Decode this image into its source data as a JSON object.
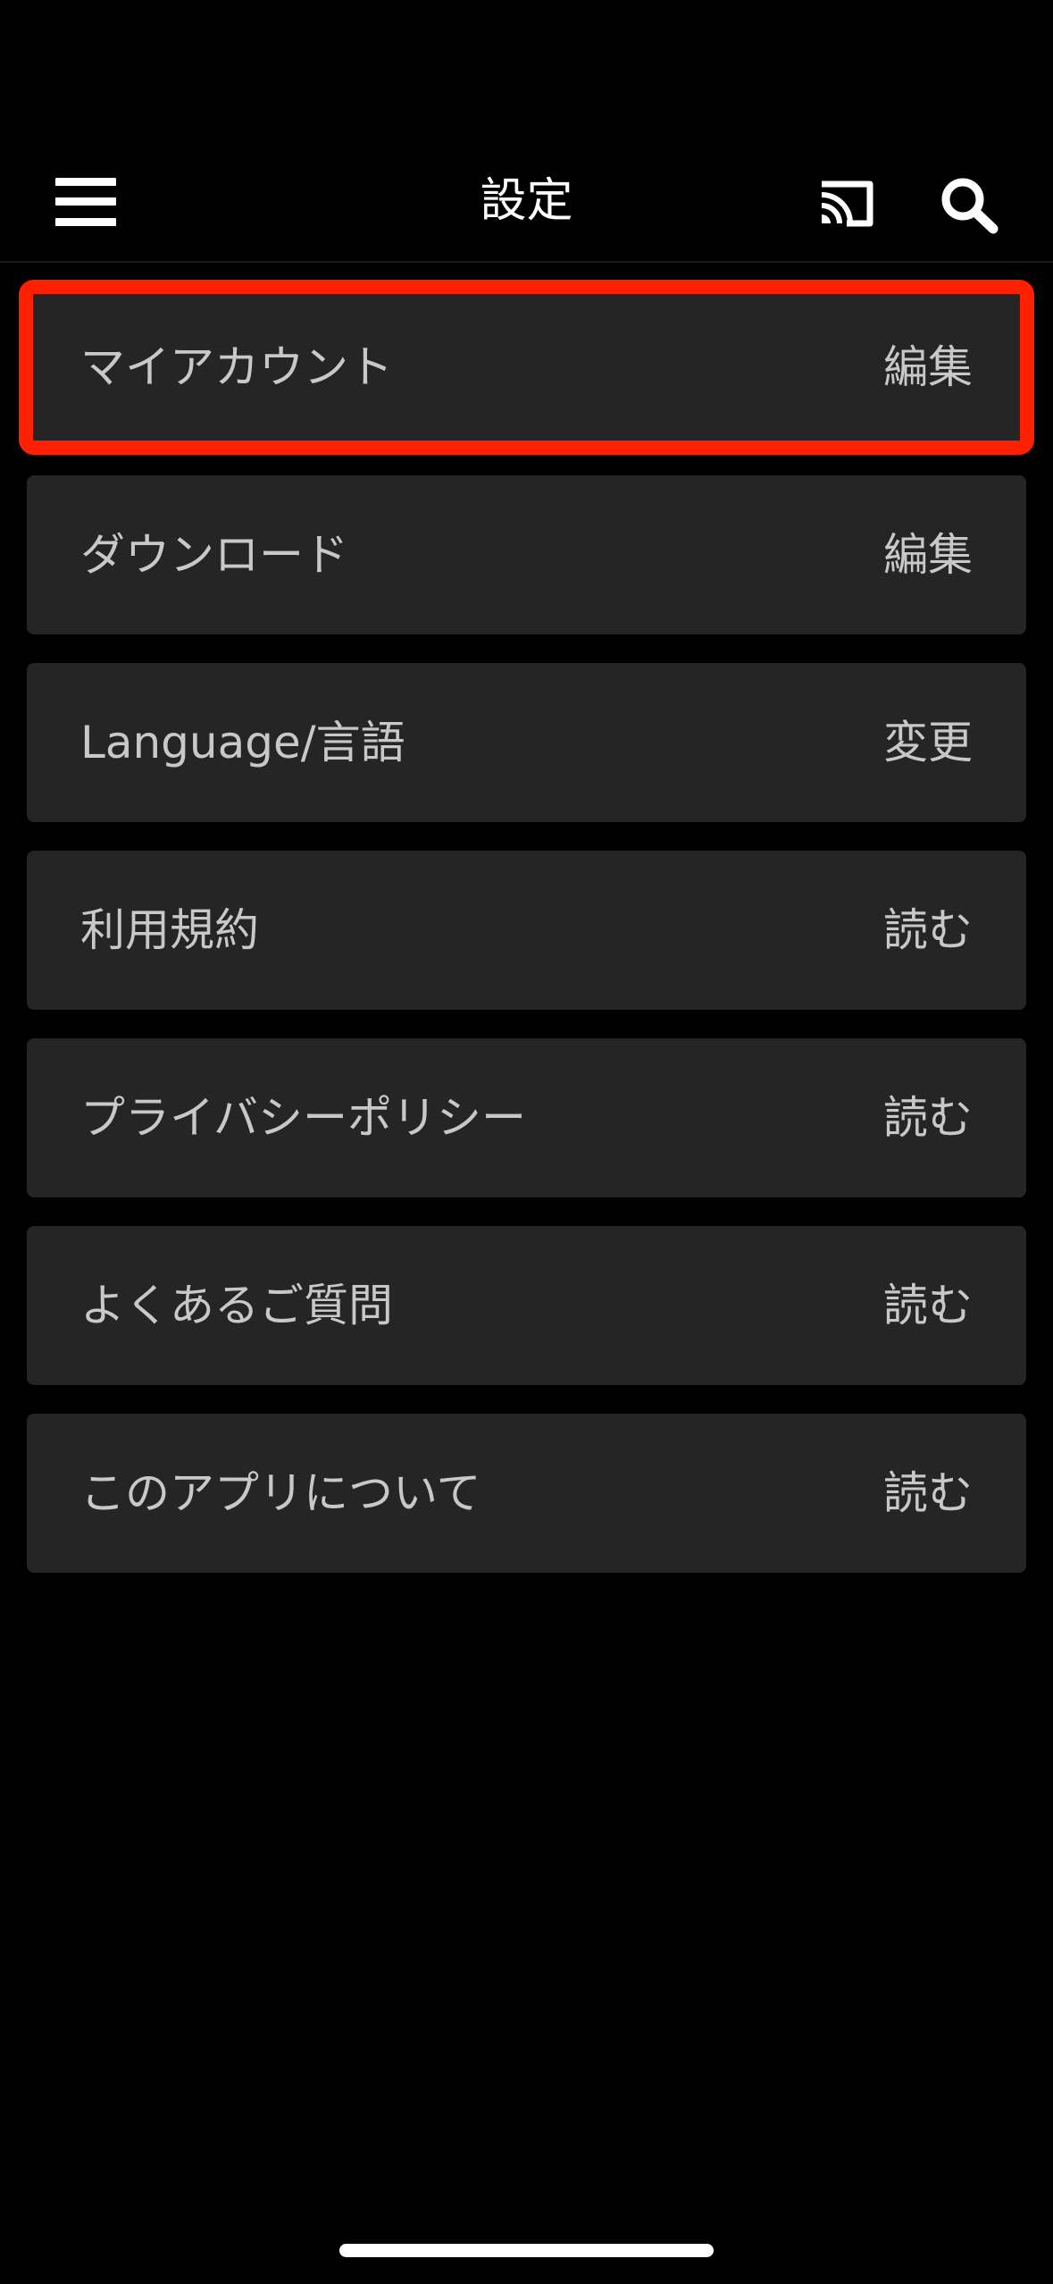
{
  "header": {
    "title": "設定",
    "menu_icon": "hamburger-menu-icon",
    "cast_icon": "cast-icon",
    "search_icon": "search-icon"
  },
  "settings": {
    "items": [
      {
        "label": "マイアカウント",
        "action": "編集",
        "highlighted": true
      },
      {
        "label": "ダウンロード",
        "action": "編集"
      },
      {
        "label": "Language/言語",
        "action": "変更"
      },
      {
        "label": "利用規約",
        "action": "読む"
      },
      {
        "label": "プライバシーポリシー",
        "action": "読む"
      },
      {
        "label": "よくあるご質問",
        "action": "読む"
      },
      {
        "label": "このアプリについて",
        "action": "読む"
      }
    ]
  },
  "colors": {
    "background": "#000000",
    "row_background": "#252525",
    "row_text": "#c8c8c8",
    "highlight": "#ff2000"
  }
}
